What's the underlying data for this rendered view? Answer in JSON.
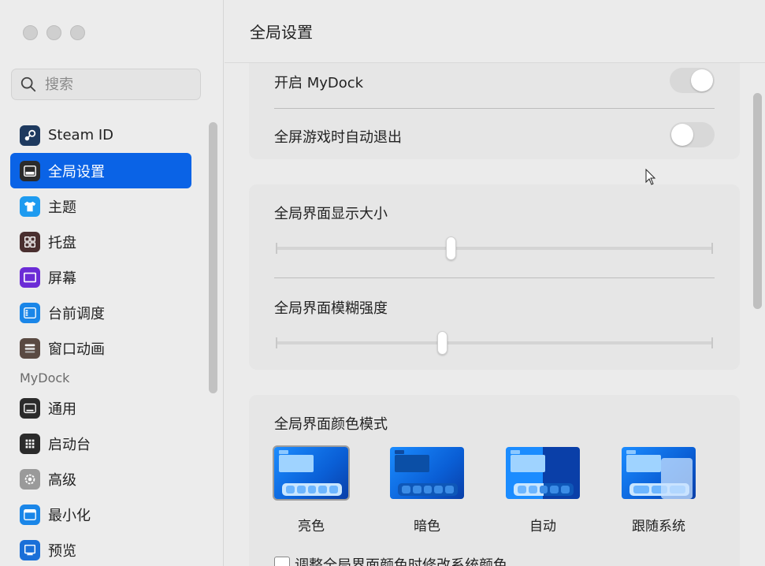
{
  "window": {
    "title": "全局设置"
  },
  "search": {
    "placeholder": "搜索"
  },
  "sidebar": {
    "items": [
      {
        "label": "Steam ID",
        "icon": "steam-icon",
        "color": "#1e3a5f"
      },
      {
        "label": "全局设置",
        "icon": "window-icon",
        "color": "#2b2b2b",
        "active": true
      },
      {
        "label": "主题",
        "icon": "tshirt-icon",
        "color": "#1e9bf0"
      },
      {
        "label": "托盘",
        "icon": "grid-icon",
        "color": "#4a2f2f"
      },
      {
        "label": "屏幕",
        "icon": "screen-icon",
        "color": "#6b2bd6"
      },
      {
        "label": "台前调度",
        "icon": "stage-manager-icon",
        "color": "#1a86e8"
      },
      {
        "label": "窗口动画",
        "icon": "window-animation-icon",
        "color": "#5a4a42"
      }
    ],
    "section_label": "MyDock",
    "section_items": [
      {
        "label": "通用",
        "icon": "dock-general-icon",
        "color": "#2b2b2b"
      },
      {
        "label": "启动台",
        "icon": "launchpad-icon",
        "color": "#2b2b2b"
      },
      {
        "label": "高级",
        "icon": "gear-icon",
        "color": "#8a8a8a"
      },
      {
        "label": "最小化",
        "icon": "minimize-icon",
        "color": "#1a86e8"
      },
      {
        "label": "预览",
        "icon": "preview-icon",
        "color": "#1a6fd8"
      }
    ]
  },
  "main": {
    "toggles": [
      {
        "label": "开启 MyDock",
        "on": false
      },
      {
        "label": "全屏游戏时自动退出",
        "on": false
      }
    ],
    "sliders": [
      {
        "label": "全局界面显示大小",
        "value": 0.4
      },
      {
        "label": "全局界面模糊强度",
        "value": 0.38
      }
    ],
    "color_mode": {
      "label": "全局界面颜色模式",
      "options": [
        {
          "label": "亮色",
          "selected": true
        },
        {
          "label": "暗色",
          "selected": false
        },
        {
          "label": "自动",
          "selected": false
        },
        {
          "label": "跟随系统",
          "selected": false
        }
      ]
    },
    "checkbox": {
      "label": "调整全局界面颜色时修改系统颜色",
      "checked": false
    }
  }
}
